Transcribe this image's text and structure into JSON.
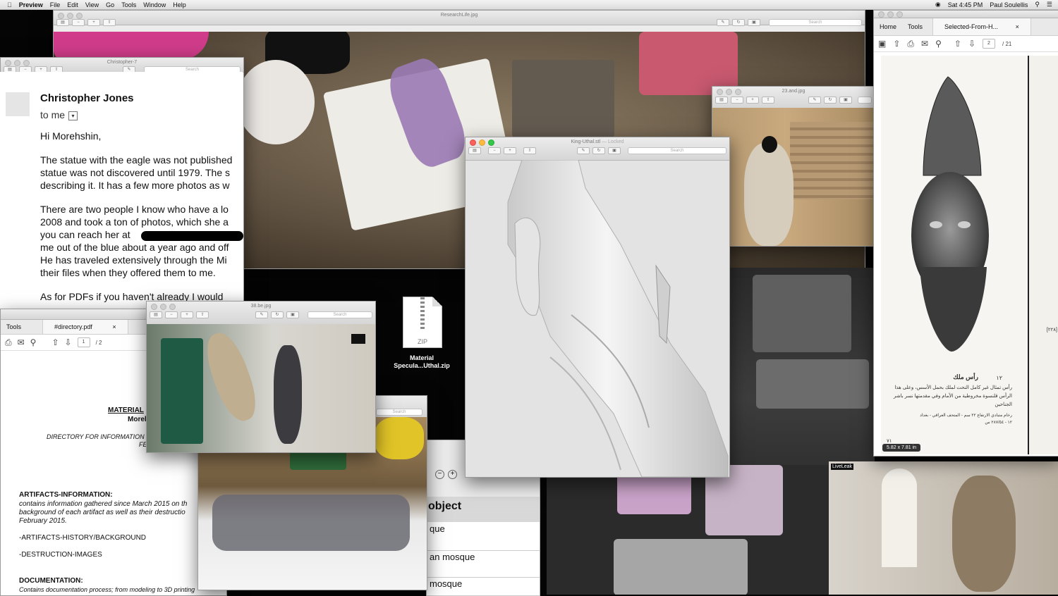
{
  "menubar": {
    "app": "Preview",
    "items": [
      "File",
      "Edit",
      "View",
      "Go",
      "Tools",
      "Window",
      "Help"
    ],
    "clock": "Sat 4:45 PM",
    "user": "Paul Soulellis"
  },
  "windows": {
    "research": {
      "title": "ResearchLife.jpg"
    },
    "christopher": {
      "title": "Christopher-7"
    },
    "king": {
      "title": "King-Uthal.stl",
      "state": "— Locked"
    },
    "image23": {
      "title": "23.and.jpg"
    },
    "image38": {
      "title": "38.be.jpg"
    },
    "search_placeholder": "Search"
  },
  "email": {
    "sender": "Christopher Jones",
    "to": "to me",
    "greeting": "Hi Morehshin,",
    "p1": "The statue with the eagle was not published\nstatue was not discovered until 1979. The s\ndescribing it. It has a few more photos as w",
    "p2": "There are two people I know who have a lo\n2008 and took a ton of photos, which she a\nyou can reach her at\nme out of the blue about a year ago and off\nHe has traveled extensively through the Mi\ntheir files when they offered them to me.",
    "p3": "As for PDFs if you haven't already I would"
  },
  "directory_pdf": {
    "tools": "Tools",
    "tab": "#directory.pdf",
    "page": "1",
    "pages": "/ 2",
    "heading": "MATERIAL",
    "sub": "Morel",
    "directory_line": "DIRECTORY FOR INFORMATION F",
    "directory_line2": "FE",
    "artifacts_heading": "ARTIFACTS-INFORMATION:",
    "artifacts_text1": "contains information gathered since March 2015 on th",
    "artifacts_text2": "background of each artifact as well as their destructio",
    "artifacts_text3": "February 2015.",
    "history": "-ARTIFACTS-HISTORY/BACKGROUND",
    "destruction": "-DESTRUCTION-IMAGES",
    "doc_heading": "DOCUMENTATION:",
    "doc_text": "Contains documentation process; from modeling to 3D printing"
  },
  "selected_pdf": {
    "home": "Home",
    "tools": "Tools",
    "tab": "Selected-From-H...",
    "page": "2",
    "pages": "/ 21",
    "size_badge": "5.82 x 7.81 in",
    "caption_num": "١٢",
    "caption_title": "رأس ملك",
    "caption_lines": [
      "رأس تمثال غير كامل النحت لملك بحمل الأسس، وعلى هذا",
      "الرأس قلنسوة مخروطية من الأمام وفي مقدمتها نسر باشر",
      "الجناحين"
    ],
    "caption_small": "رخام متبادي الارتفاع ٢٢ سم - المتحف العراقي - بغداد",
    "caption_ref": "١٢ - ٢٨٧/٥٤ س",
    "side_num": "[٢٢٨]",
    "page_num": "٧١"
  },
  "desktop": {
    "zip_label": "ZIP",
    "zip_name": "Material\nSpecula...Uthal.zip"
  },
  "table_window": {
    "header": "object",
    "rows": [
      "que",
      "an mosque",
      " mosque"
    ]
  },
  "liveleak": "LiveLeak"
}
